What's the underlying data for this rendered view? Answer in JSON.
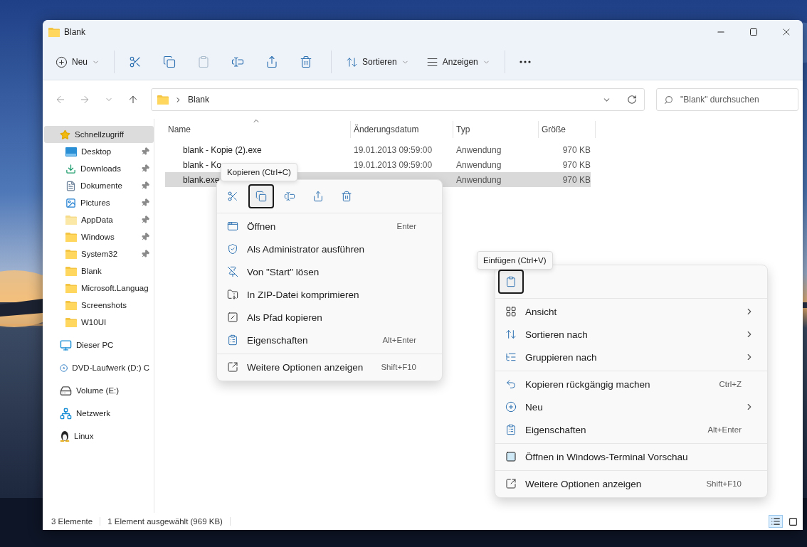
{
  "window": {
    "title": "Blank"
  },
  "toolbar": {
    "new_label": "Neu",
    "icon_buttons": [
      {
        "kind": "cut",
        "disabled": false
      },
      {
        "kind": "copy",
        "disabled": false
      },
      {
        "kind": "paste",
        "disabled": true
      },
      {
        "kind": "rename",
        "disabled": false
      },
      {
        "kind": "share",
        "disabled": false
      },
      {
        "kind": "delete",
        "disabled": false
      }
    ],
    "sort_label": "Sortieren",
    "view_label": "Anzeigen"
  },
  "address": {
    "path": [
      "Blank"
    ]
  },
  "search": {
    "placeholder": "\"Blank\" durchsuchen"
  },
  "sidebar": [
    {
      "label": "Schnellzugriff",
      "kind": "quick",
      "selected": true,
      "children": [
        {
          "label": "Desktop",
          "kind": "desktop",
          "pinned": true,
          "selected": false
        },
        {
          "label": "Downloads",
          "kind": "downloads",
          "pinned": true,
          "selected": false
        },
        {
          "label": "Dokumente",
          "kind": "documents",
          "pinned": true,
          "selected": false
        },
        {
          "label": "Pictures",
          "kind": "pictures",
          "pinned": true,
          "selected": false
        },
        {
          "label": "AppData",
          "kind": "folder-light",
          "pinned": true,
          "selected": false
        },
        {
          "label": "Windows",
          "kind": "folder",
          "pinned": true,
          "selected": false
        },
        {
          "label": "System32",
          "kind": "folder",
          "pinned": true,
          "selected": false
        },
        {
          "label": "Blank",
          "kind": "folder",
          "pinned": false,
          "selected": false
        },
        {
          "label": "Microsoft.Languag",
          "kind": "folder",
          "pinned": false,
          "selected": false
        },
        {
          "label": "Screenshots",
          "kind": "folder",
          "pinned": false,
          "selected": false
        },
        {
          "label": "W10UI",
          "kind": "folder",
          "pinned": false,
          "selected": false
        }
      ]
    },
    {
      "label": "Dieser PC",
      "kind": "pc",
      "selected": false
    },
    {
      "label": "DVD-Laufwerk (D:) C",
      "kind": "dvd",
      "selected": false
    },
    {
      "label": "Volume (E:)",
      "kind": "drive",
      "selected": false
    },
    {
      "label": "Netzwerk",
      "kind": "network",
      "selected": false
    },
    {
      "label": "Linux",
      "kind": "linux",
      "selected": false
    }
  ],
  "columns": [
    {
      "label": "Name",
      "sorted": true
    },
    {
      "label": "Änderungsdatum",
      "sorted": false
    },
    {
      "label": "Typ",
      "sorted": false
    },
    {
      "label": "Größe",
      "sorted": false
    }
  ],
  "rows": [
    {
      "name": "blank - Kopie (2).exe",
      "date": "19.01.2013 09:59:00",
      "type": "Anwendung",
      "size": "970 KB",
      "selected": false
    },
    {
      "name": "blank - Ko",
      "date": "19.01.2013 09:59:00",
      "type": "Anwendung",
      "size": "970 KB",
      "selected": false
    },
    {
      "name": "blank.exe",
      "type": "Anwendung",
      "size": "970 KB",
      "selected": true
    }
  ],
  "status": {
    "count": "3 Elemente",
    "selection": "1 Element ausgewählt (969 KB)"
  },
  "view_toggles": [
    {
      "kind": "details",
      "selected": true
    },
    {
      "kind": "tiles",
      "selected": false
    }
  ],
  "file_menu": {
    "tooltip": "Kopieren (Ctrl+C)",
    "icon_buttons": [
      {
        "kind": "cut",
        "selected": false
      },
      {
        "kind": "copy",
        "selected": true
      },
      {
        "kind": "rename",
        "selected": false
      },
      {
        "kind": "share",
        "selected": false
      },
      {
        "kind": "delete",
        "selected": false
      }
    ],
    "groups": [
      [
        {
          "kind": "open",
          "label": "Öffnen",
          "shortcut": "Enter"
        },
        {
          "kind": "admin",
          "label": "Als Administrator ausführen"
        },
        {
          "kind": "unpin",
          "label": "Von \"Start\" lösen"
        },
        {
          "kind": "zip",
          "label": "In ZIP-Datei komprimieren"
        },
        {
          "kind": "path",
          "label": "Als Pfad kopieren"
        },
        {
          "kind": "properties",
          "label": "Eigenschaften",
          "shortcut": "Alt+Enter"
        }
      ],
      [
        {
          "kind": "more",
          "label": "Weitere Optionen anzeigen",
          "shortcut": "Shift+F10"
        }
      ]
    ]
  },
  "background_menu": {
    "tooltip": "Einfügen (Ctrl+V)",
    "icon_buttons": [
      {
        "kind": "paste",
        "selected": true
      }
    ],
    "groups": [
      [
        {
          "kind": "view",
          "label": "Ansicht",
          "submenu": true
        },
        {
          "kind": "sort",
          "label": "Sortieren nach",
          "submenu": true
        },
        {
          "kind": "group",
          "label": "Gruppieren nach",
          "submenu": true
        }
      ],
      [
        {
          "kind": "undo",
          "label": "Kopieren rückgängig machen",
          "shortcut": "Ctrl+Z",
          "submenu": false
        },
        {
          "kind": "new",
          "label": "Neu",
          "submenu": true
        },
        {
          "kind": "properties",
          "label": "Eigenschaften",
          "shortcut": "Alt+Enter",
          "submenu": false
        }
      ],
      [
        {
          "kind": "terminal",
          "label": "Öffnen in Windows-Terminal Vorschau",
          "submenu": false
        }
      ],
      [
        {
          "kind": "more",
          "label": "Weitere Optionen anzeigen",
          "shortcut": "Shift+F10",
          "submenu": false
        }
      ]
    ]
  }
}
